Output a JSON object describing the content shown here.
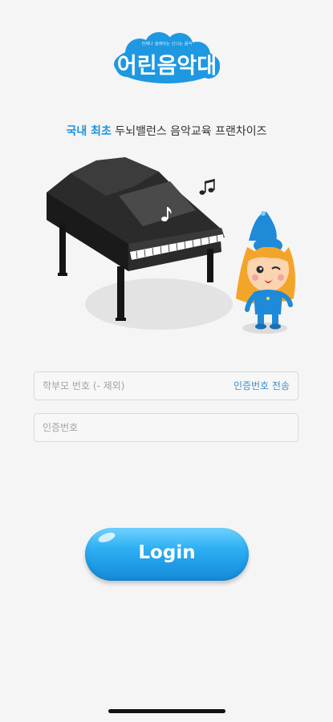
{
  "logo": {
    "tagline": "언제나 설레이는 신나는 음악",
    "text": "어린음악대"
  },
  "slogan": {
    "highlight": "국내 최초",
    "rest": " 두뇌밸런스 음악교육 프랜차이즈"
  },
  "form": {
    "phone_placeholder": "학부모 번호 (- 제외)",
    "send_code_label": "인증번호 전송",
    "code_placeholder": "인증번호"
  },
  "login": {
    "label": "Login"
  },
  "colors": {
    "accent": "#1c93df",
    "button": "#2fb0f3",
    "background": "#f5f5f5"
  }
}
